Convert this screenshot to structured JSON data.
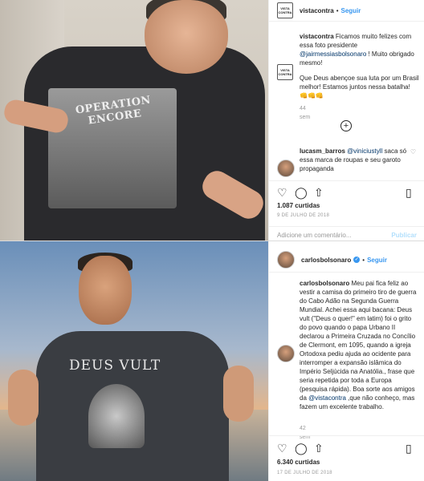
{
  "post1": {
    "shirt_text": "OPERATION ENCORE",
    "header": {
      "username": "vistacontra",
      "separator": "•",
      "follow_label": "Seguir",
      "avatar_text": "VISTA CONTRA"
    },
    "caption": {
      "username": "vistacontra",
      "text_a": " Ficamos muito felizes com essa foto presidente ",
      "mention": "@jairmessiasbolsonaro",
      "text_b": " ! Muito obrigado mesmo!",
      "text_c": "Que Deus abençoe sua luta por um Brasil melhor! Estamos juntos nessa batalha! 👊👊👊",
      "time": "44 sem"
    },
    "load_more_icon": "plus-circle-icon",
    "comment": {
      "username": "lucasm_barros",
      "mention": "@viniciustyll",
      "text": "saca só essa marca de roupas e seu garoto propaganda"
    },
    "likes": "1.087 curtidas",
    "date": "9 DE JULHO DE 2018",
    "add_comment_placeholder": "Adicione um comentário...",
    "publish_label": "Publicar"
  },
  "post2": {
    "shirt_text": "DEUS VULT",
    "header": {
      "username": "carlosbolsonaro",
      "verified_mark": "✓",
      "separator": "•",
      "follow_label": "Seguir"
    },
    "caption": {
      "username": "carlosbolsonaro",
      "text_a": " Meu pai fica feliz ao vestir a camisa do primeiro tiro de guerra do Cabo Adão na Segunda Guerra Mundial. Achei essa aqui bacana: Deus vult (\"Deus o quer!\" em latim) foi o grito do povo quando o papa Urbano II declarou a Primeira Cruzada no Concílio de Clermont, em 1095, quando a igreja Ortodoxa pediu ajuda ao ocidente para interromper a expansão islâmica do Império Seljúcida na Anatólia., frase que seria repetida por toda a Europa (pesquisa rápida). Boa sorte aos amigos da ",
      "mention": "@vistacontra",
      "text_b": " ,que não conheço, mas fazem um excelente trabalho.",
      "time": "42 sem"
    },
    "likes": "6.340 curtidas",
    "date": "17 DE JULHO DE 2018"
  },
  "icons": {
    "like": "heart-icon",
    "comment": "comment-icon",
    "share": "share-icon",
    "save": "bookmark-icon"
  },
  "colors": {
    "link_blue": "#3897f0",
    "mention_blue": "#003569"
  }
}
